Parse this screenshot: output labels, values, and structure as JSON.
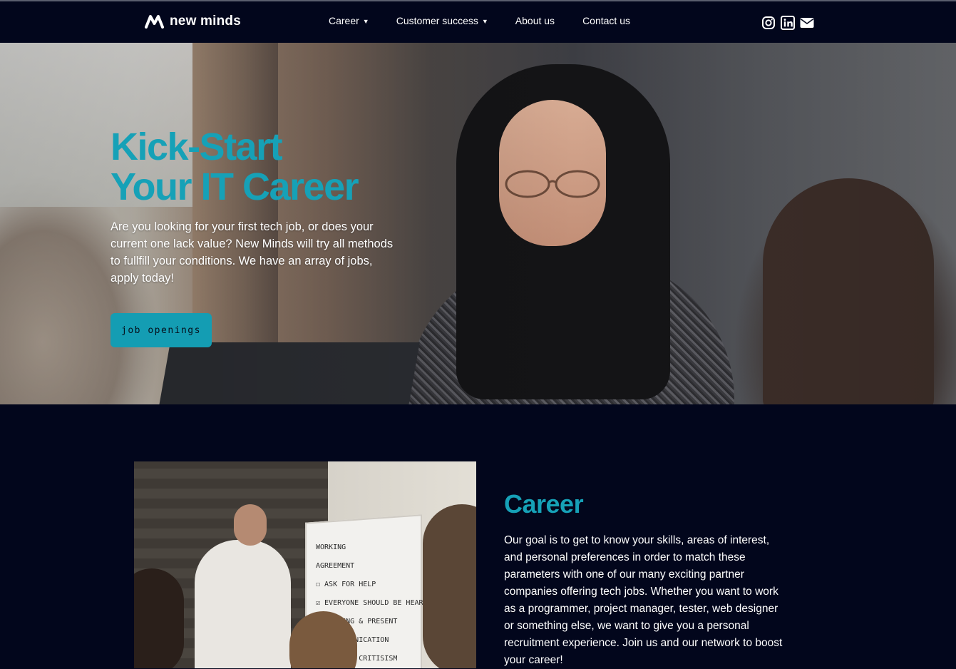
{
  "brand": {
    "name": "new minds",
    "logo_icon": "new-minds-logo"
  },
  "nav": {
    "items": [
      {
        "label": "Career",
        "has_dropdown": true
      },
      {
        "label": "Customer success",
        "has_dropdown": true
      },
      {
        "label": "About us",
        "has_dropdown": false
      },
      {
        "label": "Contact us",
        "has_dropdown": false
      }
    ],
    "dropdown_icon": "chevron-down-icon"
  },
  "social": {
    "icons": [
      "instagram-icon",
      "linkedin-icon",
      "envelope-icon"
    ]
  },
  "hero": {
    "title_line1": "Kick-Start",
    "title_line2": "Your IT Career",
    "text": "Are you looking for your first tech job, or does your current one lack value? New Minds will try all methods to fullfill your conditions. We have an array of jobs, apply today!",
    "button_label": "job openings"
  },
  "career": {
    "title": "Career",
    "text": "Our goal is to get to know your skills, areas of interest, and personal preferences in order to match these parameters with one of our many exciting partner companies offering tech jobs. Whether you want to work as a programmer, project manager, tester, web designer or something else, we want to give you a personal recruitment experience. Join us and our network to boost your career!",
    "image_board_text": "WORKING\nAGREEMENT\n☐ ASK FOR HELP\n☑ EVERYONE SHOULD BE HEARD\n  ...TING & PRESENT\n  ...OMMUNICATION\n  ...TIVE CRITISISM"
  },
  "colors": {
    "accent": "#16a1b7",
    "background": "#02061c",
    "button": "#149db3"
  }
}
